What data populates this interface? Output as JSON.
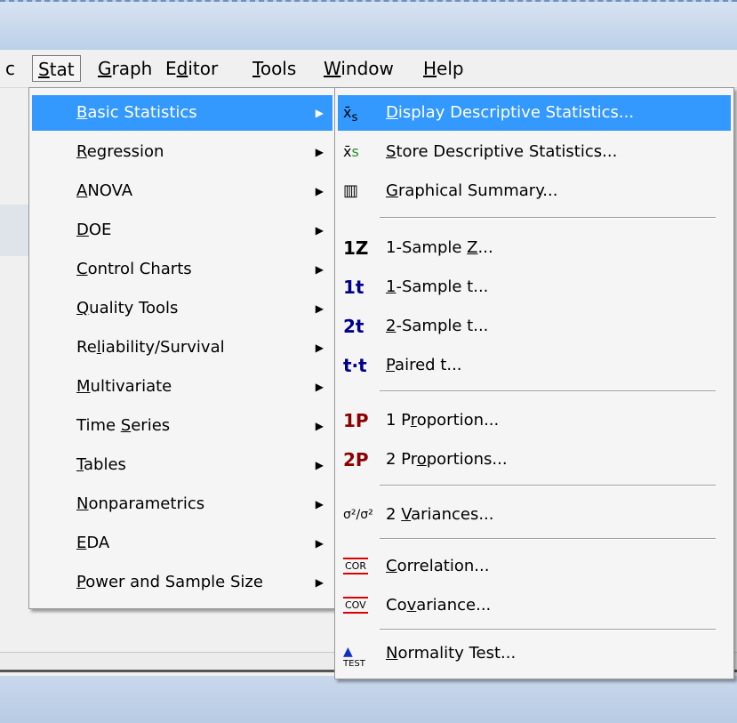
{
  "menubar": [
    {
      "label": "c"
    },
    {
      "pre": "",
      "u": "S",
      "post": "tat"
    },
    {
      "pre": "",
      "u": "G",
      "post": "raph"
    },
    {
      "pre": "E",
      "u": "d",
      "post": "itor"
    },
    {
      "pre": "",
      "u": "T",
      "post": "ools"
    },
    {
      "pre": "",
      "u": "W",
      "post": "indow"
    },
    {
      "pre": "",
      "u": "H",
      "post": "elp"
    }
  ],
  "stat_menu": [
    {
      "pre": "",
      "u": "B",
      "post": "asic Statistics",
      "submenu": true
    },
    {
      "pre": "",
      "u": "R",
      "post": "egression",
      "submenu": true
    },
    {
      "pre": "",
      "u": "A",
      "post": "NOVA",
      "submenu": true
    },
    {
      "pre": "",
      "u": "D",
      "post": "OE",
      "submenu": true
    },
    {
      "pre": "",
      "u": "C",
      "post": "ontrol Charts",
      "submenu": true
    },
    {
      "pre": "",
      "u": "Q",
      "post": "uality Tools",
      "submenu": true
    },
    {
      "pre": "Re",
      "u": "l",
      "post": "iability/Survival",
      "submenu": true
    },
    {
      "pre": "",
      "u": "M",
      "post": "ultivariate",
      "submenu": true
    },
    {
      "pre": "Time ",
      "u": "S",
      "post": "eries",
      "submenu": true
    },
    {
      "pre": "",
      "u": "T",
      "post": "ables",
      "submenu": true
    },
    {
      "pre": "",
      "u": "N",
      "post": "onparametrics",
      "submenu": true
    },
    {
      "pre": "",
      "u": "E",
      "post": "DA",
      "submenu": true
    },
    {
      "pre": "",
      "u": "P",
      "post": "ower and Sample Size",
      "submenu": true
    }
  ],
  "basic_statistics_menu": [
    {
      "icon": "x̄s",
      "pre": "",
      "u": "D",
      "post": "isplay Descriptive Statistics..."
    },
    {
      "icon": "x̄s",
      "pre": "",
      "u": "S",
      "post": "tore Descriptive Statistics..."
    },
    {
      "icon": "▥",
      "pre": "",
      "u": "G",
      "post": "raphical Summary..."
    },
    {
      "icon": "1Z",
      "pre": "1-Sample ",
      "u": "Z",
      "post": "..."
    },
    {
      "icon": "1t",
      "pre": "",
      "u": "1",
      "post": "-Sample t..."
    },
    {
      "icon": "2t",
      "pre": "",
      "u": "2",
      "post": "-Sample t..."
    },
    {
      "icon": "t·t",
      "pre": "",
      "u": "P",
      "post": "aired t..."
    },
    {
      "icon": "1P",
      "pre": "1 P",
      "u": "r",
      "post": "oportion..."
    },
    {
      "icon": "2P",
      "pre": "2 Pr",
      "u": "o",
      "post": "portions..."
    },
    {
      "icon": "σ/σ",
      "pre": "2 ",
      "u": "V",
      "post": "ariances..."
    },
    {
      "icon": "COR",
      "pre": "",
      "u": "C",
      "post": "orrelation..."
    },
    {
      "icon": "COV",
      "pre": "Co",
      "u": "v",
      "post": "ariance..."
    },
    {
      "icon": "TEST",
      "pre": "",
      "u": "N",
      "post": "ormality Test..."
    }
  ],
  "colors": {
    "highlight": "#3399ff",
    "menu_bg": "#f5f5f5",
    "icon_blue": "#00008b",
    "icon_red": "#8b0000",
    "titlebar": "#c9d8ec"
  },
  "icon_names": {
    "submenu_arrow": "chevron-right-icon"
  }
}
